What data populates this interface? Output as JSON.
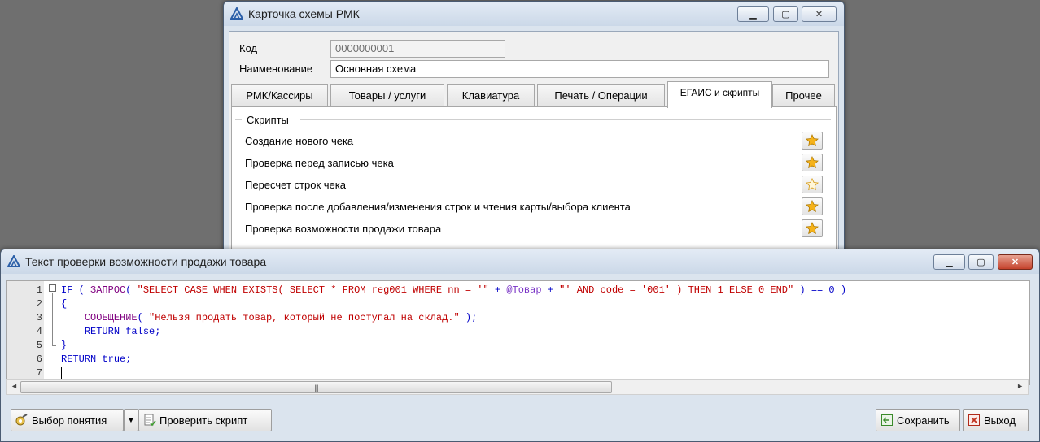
{
  "card_window": {
    "title": "Карточка схемы РМК",
    "fields": {
      "code_label": "Код",
      "code_value": "0000000001",
      "name_label": "Наименование",
      "name_value": "Основная схема"
    },
    "tabs": [
      {
        "label": "РМК/Кассиры",
        "active": false
      },
      {
        "label": "Товары / услуги",
        "active": false
      },
      {
        "label": "Клавиатура",
        "active": false
      },
      {
        "label": "Печать / Операции",
        "active": false
      },
      {
        "label": "ЕГАИС и скрипты",
        "active": true
      },
      {
        "label": "Прочее",
        "active": false
      }
    ],
    "group_title": "Скрипты",
    "scripts": [
      {
        "label": "Создание нового чека",
        "has_script": true
      },
      {
        "label": "Проверка перед записью чека",
        "has_script": true
      },
      {
        "label": "Пересчет строк чека",
        "has_script": false
      },
      {
        "label": "Проверка после добавления/изменения строк и чтения карты/выбора клиента",
        "has_script": true
      },
      {
        "label": "Проверка возможности продажи товара",
        "has_script": true
      }
    ]
  },
  "editor_window": {
    "title": "Текст проверки возможности продажи товара",
    "line_numbers": [
      "1",
      "2",
      "3",
      "4",
      "5",
      "6",
      "7"
    ],
    "code_lines": [
      "IF ( ЗАПРОС( \"SELECT CASE WHEN EXISTS( SELECT * FROM reg001 WHERE nn = '\" + @Товар + \"' AND code = '001' ) THEN 1 ELSE 0 END\" ) == 0 )",
      "{",
      "    СООБЩЕНИЕ( \"Нельзя продать товар, который не поступал на склад.\" );",
      "    RETURN false;",
      "}",
      "RETURN true;",
      ""
    ],
    "buttons": {
      "select_concept": "Выбор понятия",
      "check_script": "Проверить скрипт",
      "save": "Сохранить",
      "exit": "Выход"
    }
  },
  "colors": {
    "keyword": "#0000c8",
    "function": "#800080",
    "string": "#c00000",
    "variable": "#7a35c6",
    "star": "#f5b21a"
  }
}
